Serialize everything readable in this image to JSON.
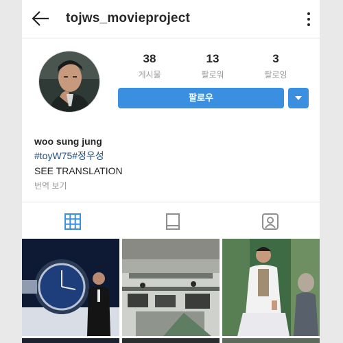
{
  "header": {
    "username": "tojws_movieproject",
    "back_icon": "arrow-left-icon",
    "more_icon": "more-vertical-icon"
  },
  "profile": {
    "stats": [
      {
        "value": "38",
        "label": "게시물"
      },
      {
        "value": "13",
        "label": "팔로워"
      },
      {
        "value": "3",
        "label": "팔로잉"
      }
    ],
    "follow_label": "팔로우",
    "accent_color": "#3a8fe0"
  },
  "bio": {
    "name": "woo sung jung",
    "hashtags": "#toyW75#정우성",
    "see_translation": "SEE TRANSLATION",
    "see_translation_ko": "번역 보기"
  },
  "tabs": [
    {
      "icon": "grid-icon",
      "active": true
    },
    {
      "icon": "feed-icon",
      "active": false
    },
    {
      "icon": "tagged-user-icon",
      "active": false
    }
  ]
}
